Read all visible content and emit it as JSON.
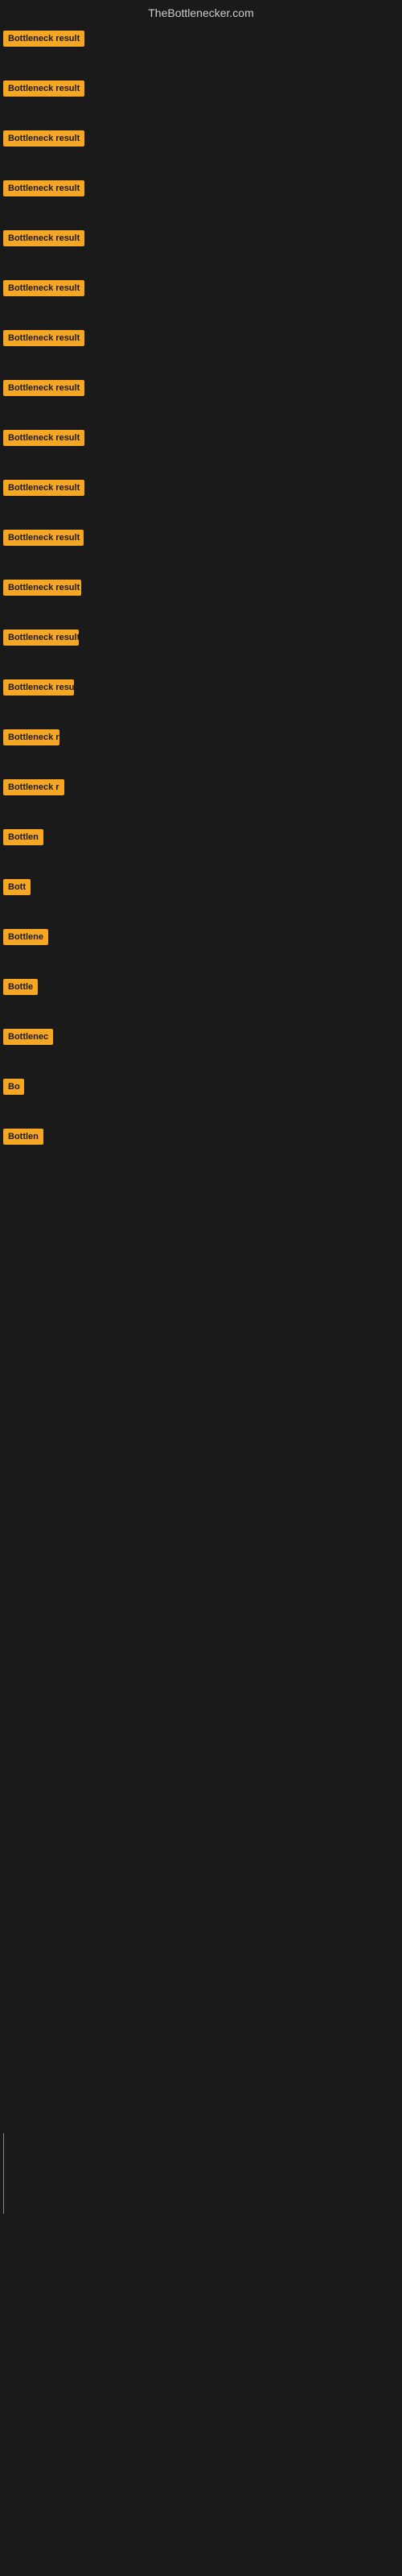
{
  "site": {
    "title": "TheBottlenecker.com"
  },
  "rows": [
    {
      "id": 1,
      "label": "Bottleneck result"
    },
    {
      "id": 2,
      "label": "Bottleneck result"
    },
    {
      "id": 3,
      "label": "Bottleneck result"
    },
    {
      "id": 4,
      "label": "Bottleneck result"
    },
    {
      "id": 5,
      "label": "Bottleneck result"
    },
    {
      "id": 6,
      "label": "Bottleneck result"
    },
    {
      "id": 7,
      "label": "Bottleneck result"
    },
    {
      "id": 8,
      "label": "Bottleneck result"
    },
    {
      "id": 9,
      "label": "Bottleneck result"
    },
    {
      "id": 10,
      "label": "Bottleneck result"
    },
    {
      "id": 11,
      "label": "Bottleneck result"
    },
    {
      "id": 12,
      "label": "Bottleneck result"
    },
    {
      "id": 13,
      "label": "Bottleneck result"
    },
    {
      "id": 14,
      "label": "Bottleneck result"
    },
    {
      "id": 15,
      "label": "Bottleneck re"
    },
    {
      "id": 16,
      "label": "Bottleneck r"
    },
    {
      "id": 17,
      "label": "Bottlen"
    },
    {
      "id": 18,
      "label": "Bott"
    },
    {
      "id": 19,
      "label": "Bottlene"
    },
    {
      "id": 20,
      "label": "Bottle"
    },
    {
      "id": 21,
      "label": "Bottlenec"
    },
    {
      "id": 22,
      "label": "Bo"
    },
    {
      "id": 23,
      "label": "Bottlen"
    }
  ],
  "colors": {
    "badge_bg": "#f5a623",
    "badge_text": "#1a1a1a",
    "body_bg": "#1a1a1a",
    "title_text": "#cccccc"
  }
}
